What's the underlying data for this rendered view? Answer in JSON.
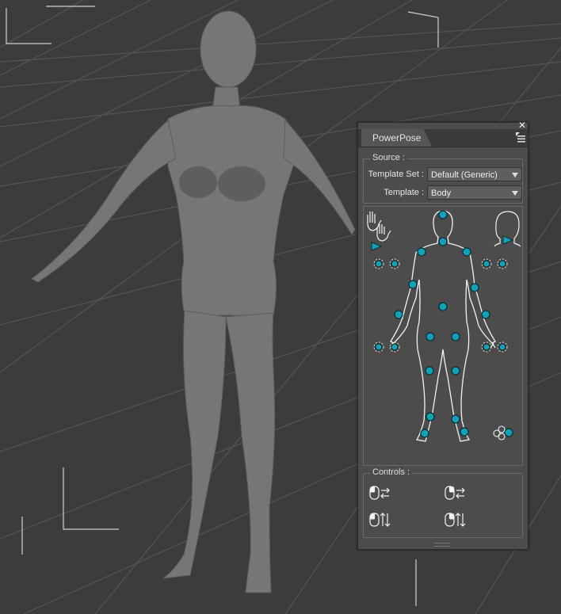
{
  "panel": {
    "tab_label": "PowerPose",
    "close_glyph": "✕",
    "source": {
      "title": "Source :",
      "template_set_label": "Template Set :",
      "template_set_value": "Default (Generic)",
      "template_label": "Template :",
      "template_value": "Body"
    },
    "controls": {
      "title": "Controls :"
    }
  },
  "icons": [
    "close-icon",
    "panel-menu-icon",
    "hands-icon",
    "head-icon",
    "mouse-drag-icon"
  ],
  "colors": {
    "node": "#0fa3b5",
    "panel": "#4c4c4c",
    "viewport": "#3c3c3c"
  }
}
